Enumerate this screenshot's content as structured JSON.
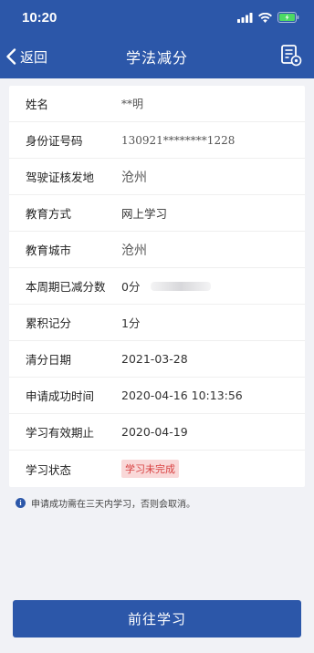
{
  "status_bar": {
    "time": "10:20"
  },
  "nav": {
    "back_label": "返回",
    "title": "学法减分"
  },
  "info": {
    "rows": [
      {
        "label": "姓名",
        "value": "**明"
      },
      {
        "label": "身份证号码",
        "value": "130921********1228"
      },
      {
        "label": "驾驶证核发地",
        "value": "沧州"
      },
      {
        "label": "教育方式",
        "value": "网上学习"
      },
      {
        "label": "教育城市",
        "value": "沧州"
      },
      {
        "label": "本周期已减分数",
        "value": "0分"
      },
      {
        "label": "累积记分",
        "value": "1分"
      },
      {
        "label": "清分日期",
        "value": "2021-03-28"
      },
      {
        "label": "申请成功时间",
        "value": "2020-04-16 10:13:56"
      },
      {
        "label": "学习有效期止",
        "value": "2020-04-19"
      },
      {
        "label": "学习状态",
        "value": "学习未完成"
      }
    ]
  },
  "note": "申请成功需在三天内学习，否则会取消。",
  "action_button": "前往学习",
  "colors": {
    "primary": "#2c57a9",
    "badge_bg": "#f9d8d8",
    "badge_text": "#d84040"
  }
}
